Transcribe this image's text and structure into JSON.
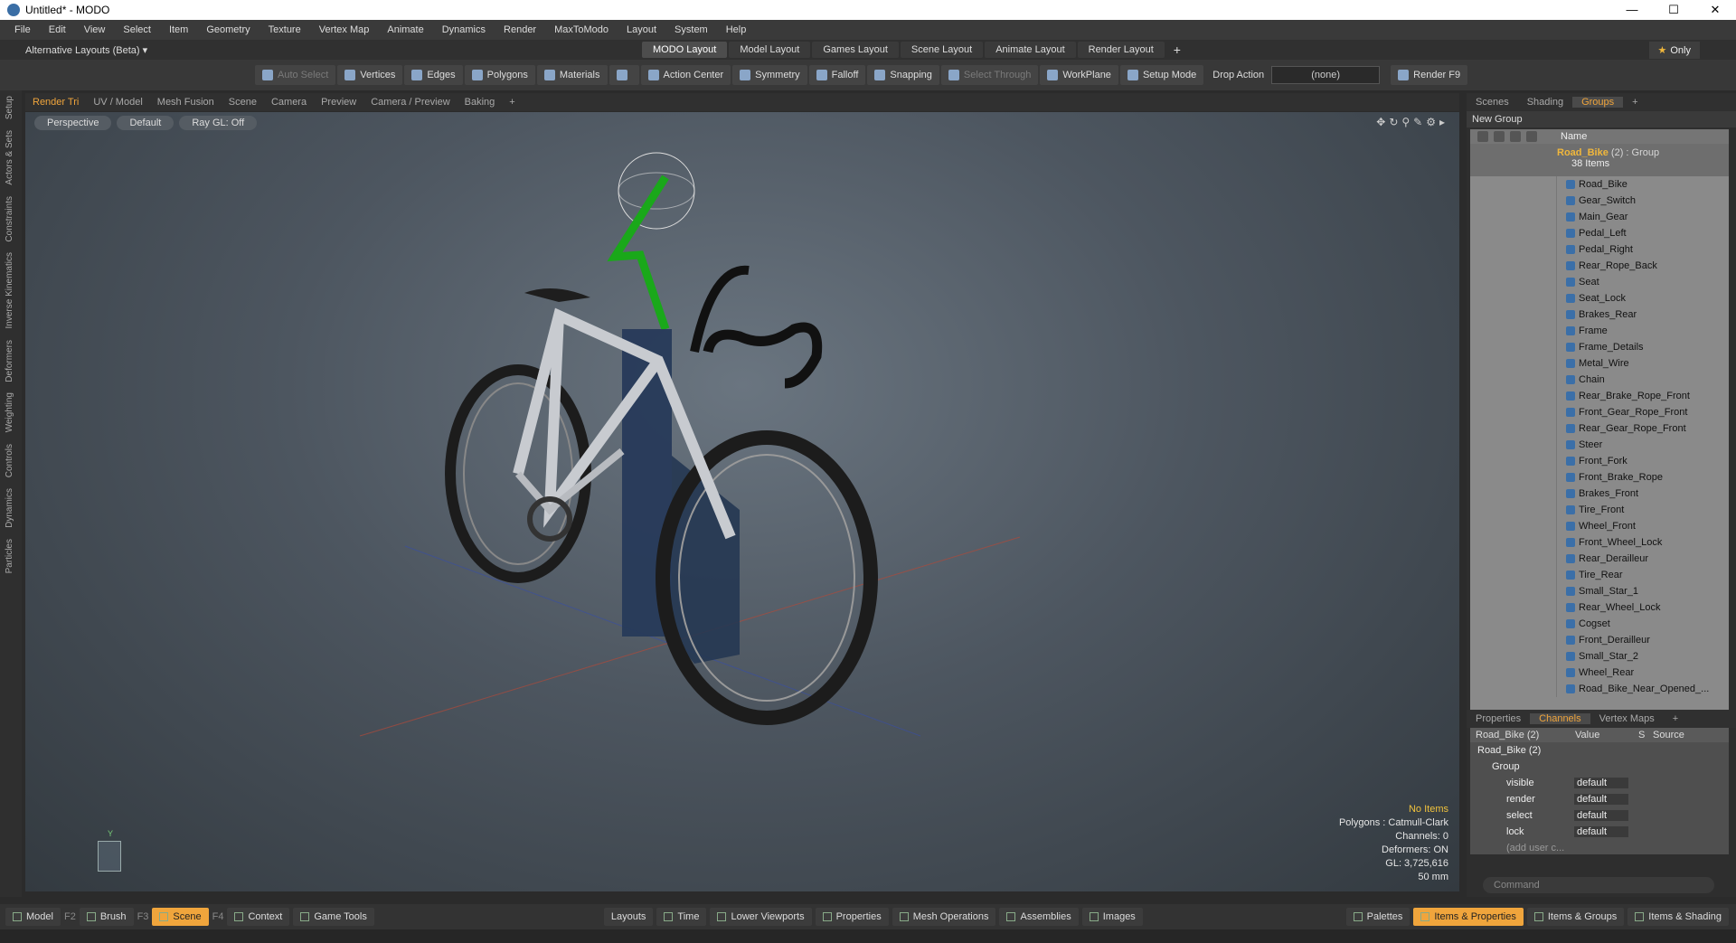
{
  "window": {
    "title": "Untitled* - MODO",
    "min": "—",
    "max": "☐",
    "close": "✕"
  },
  "menu": [
    "File",
    "Edit",
    "View",
    "Select",
    "Item",
    "Geometry",
    "Texture",
    "Vertex Map",
    "Animate",
    "Dynamics",
    "Render",
    "MaxToModo",
    "Layout",
    "System",
    "Help"
  ],
  "layoutbar": {
    "alt_layouts": "Alternative Layouts (Beta) ▾",
    "tabs": [
      "MODO Layout",
      "Model Layout",
      "Games Layout",
      "Scene Layout",
      "Animate Layout",
      "Render Layout"
    ],
    "active_tab": "MODO Layout",
    "plus": "+",
    "only": "Only"
  },
  "toolbar": {
    "auto_select": "Auto Select",
    "vertices": "Vertices",
    "edges": "Edges",
    "polygons": "Polygons",
    "materials": "Materials",
    "action_center": "Action Center",
    "symmetry": "Symmetry",
    "falloff": "Falloff",
    "snapping": "Snapping",
    "select_through": "Select Through",
    "workplane": "WorkPlane",
    "setup_mode": "Setup Mode",
    "drop_action": "Drop Action",
    "drop_value": "(none)",
    "render": "Render F9"
  },
  "lefttabs": [
    "Setup",
    "Actors & Sets",
    "Constraints",
    "Inverse Kinematics",
    "Deformers",
    "Weighting",
    "Controls",
    "Dynamics",
    "Particles"
  ],
  "viewport_tabs": [
    "Render Tri",
    "UV / Model",
    "Mesh Fusion",
    "Scene",
    "Camera",
    "Preview",
    "Camera / Preview",
    "Baking",
    "+"
  ],
  "viewport": {
    "projection": "Perspective",
    "shading": "Default",
    "raygl": "Ray GL: Off",
    "stats": {
      "items": "No Items",
      "polygons": "Polygons : Catmull-Clark",
      "channels": "Channels: 0",
      "deformers": "Deformers: ON",
      "gl": "GL: 3,725,616",
      "mm": "50 mm"
    },
    "axis_label": "Y"
  },
  "right_tabs": [
    "Scenes",
    "Shading",
    "Groups",
    "+"
  ],
  "right_active": "Groups",
  "new_group": "New Group",
  "groups": {
    "name_header": "Name",
    "group_name": "Road_Bike",
    "group_suffix": "(2) : Group",
    "count": "38 Items",
    "items": [
      "Road_Bike",
      "Gear_Switch",
      "Main_Gear",
      "Pedal_Left",
      "Pedal_Right",
      "Rear_Rope_Back",
      "Seat",
      "Seat_Lock",
      "Brakes_Rear",
      "Frame",
      "Frame_Details",
      "Metal_Wire",
      "Chain",
      "Rear_Brake_Rope_Front",
      "Front_Gear_Rope_Front",
      "Rear_Gear_Rope_Front",
      "Steer",
      "Front_Fork",
      "Front_Brake_Rope",
      "Brakes_Front",
      "Tire_Front",
      "Wheel_Front",
      "Front_Wheel_Lock",
      "Rear_Derailleur",
      "Tire_Rear",
      "Small_Star_1",
      "Rear_Wheel_Lock",
      "Cogset",
      "Front_Derailleur",
      "Small_Star_2",
      "Wheel_Rear",
      "Road_Bike_Near_Opened_..."
    ]
  },
  "channel_tabs": [
    "Properties",
    "Channels",
    "Vertex Maps",
    "+"
  ],
  "channel_active": "Channels",
  "channels": {
    "headers": [
      "Road_Bike (2)",
      "Value",
      "S",
      "Source"
    ],
    "root": "Road_Bike (2)",
    "group": "Group",
    "rows": [
      {
        "name": "visible",
        "value": "default"
      },
      {
        "name": "render",
        "value": "default"
      },
      {
        "name": "select",
        "value": "default"
      },
      {
        "name": "lock",
        "value": "default"
      }
    ],
    "add": "(add user c..."
  },
  "command_placeholder": "Command",
  "bottom": {
    "left": [
      {
        "label": "Model",
        "key": "F2"
      },
      {
        "label": "Brush",
        "key": "F3"
      },
      {
        "label": "Scene",
        "key": "F4"
      },
      {
        "label": "Context",
        "key": ""
      },
      {
        "label": "Game Tools",
        "key": ""
      }
    ],
    "center": [
      "Layouts",
      "Time",
      "Lower Viewports",
      "Properties",
      "Mesh Operations",
      "Assemblies",
      "Images"
    ],
    "right": [
      "Palettes",
      "Items & Properties",
      "Items & Groups",
      "Items & Shading"
    ]
  },
  "colors": {
    "accent": "#f0a53c",
    "group_title": "#f0b73c",
    "handle_green": "#1aa81a"
  }
}
